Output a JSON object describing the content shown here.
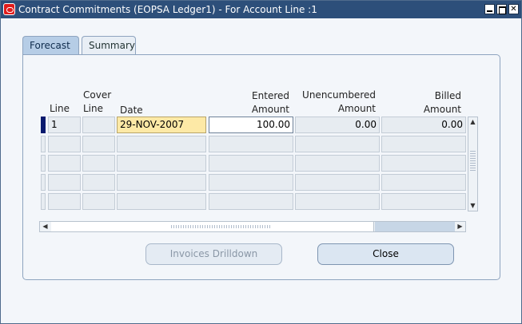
{
  "window": {
    "title": "Contract Commitments (EOPSA Ledger1) - For Account Line :1"
  },
  "tabs": [
    {
      "label": "Forecast",
      "active": true
    },
    {
      "label": "Summary",
      "active": false
    }
  ],
  "table": {
    "headers": {
      "line": "Line",
      "cover_line_1": "Cover",
      "cover_line_2": "Line",
      "date": "Date",
      "entered_1": "Entered",
      "entered_2": "Amount",
      "unenc_1": "Unencumbered",
      "unenc_2": "Amount",
      "billed_1": "Billed",
      "billed_2": "Amount"
    },
    "rows": [
      {
        "line": "1",
        "cover_line": "",
        "date": "29-NOV-2007",
        "entered_amount": "100.00",
        "unencumbered_amount": "0.00",
        "billed_amount": "0.00"
      }
    ]
  },
  "buttons": {
    "invoices_drilldown": "Invoices Drilldown",
    "close": "Close"
  },
  "colors": {
    "titlebar": "#2d4f7a",
    "active_tab": "#b6cde6",
    "current_date_cell": "#fde9a6",
    "row_indicator": "#0a1a6e"
  }
}
